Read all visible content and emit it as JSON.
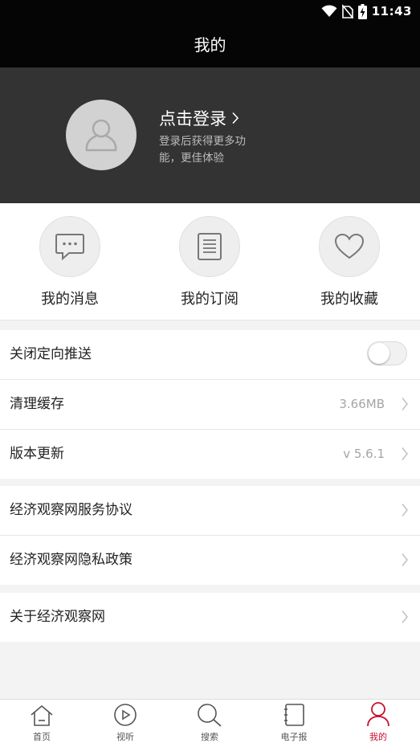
{
  "status_bar": {
    "time": "11:43",
    "icons": [
      "wifi-icon",
      "no-sim-icon",
      "battery-charging-icon"
    ]
  },
  "header": {
    "title": "我的"
  },
  "profile": {
    "login_label": "点击登录",
    "login_desc": "登录后获得更多功能，更佳体验",
    "icons": {
      "avatar": "user-avatar-icon",
      "chevron": "chevron-right-icon"
    }
  },
  "quick_actions": [
    {
      "label": "我的消息",
      "icon": "message-icon"
    },
    {
      "label": "我的订阅",
      "icon": "subscription-icon"
    },
    {
      "label": "我的收藏",
      "icon": "heart-icon"
    }
  ],
  "settings": {
    "push": {
      "label": "关闭定向推送",
      "enabled": false
    },
    "cache": {
      "label": "清理缓存",
      "value": "3.66MB"
    },
    "version": {
      "label": "版本更新",
      "value": "v 5.6.1"
    }
  },
  "legal": {
    "service_agreement": "经济观察网服务协议",
    "privacy_policy": "经济观察网隐私政策"
  },
  "about": {
    "label": "关于经济观察网"
  },
  "tabbar": {
    "items": [
      {
        "label": "首页",
        "icon": "home-icon"
      },
      {
        "label": "视听",
        "icon": "play-icon"
      },
      {
        "label": "搜索",
        "icon": "search-icon"
      },
      {
        "label": "电子报",
        "icon": "epaper-icon"
      },
      {
        "label": "我的",
        "icon": "user-icon"
      }
    ],
    "active_index": 4
  },
  "colors": {
    "accent": "#c8102e",
    "header_bg": "#050505",
    "profile_bg": "#333333",
    "page_bg": "#f3f3f3"
  }
}
